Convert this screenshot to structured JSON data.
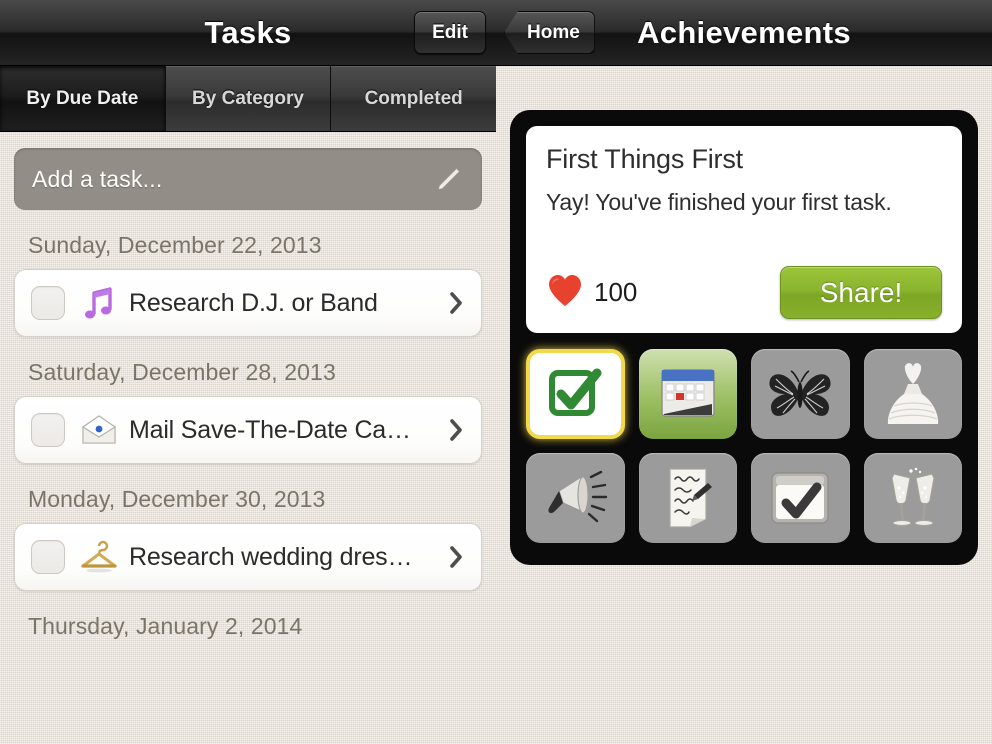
{
  "left_screen": {
    "nav": {
      "title": "Tasks",
      "edit_label": "Edit"
    },
    "segments": [
      {
        "label": "By Due Date",
        "active": true
      },
      {
        "label": "By Category",
        "active": false
      },
      {
        "label": "Completed",
        "active": false
      }
    ],
    "add_task": {
      "placeholder": "Add a task...",
      "icon": "pencil-icon"
    },
    "groups": [
      {
        "date": "Sunday, December 22, 2013",
        "tasks": [
          {
            "label": "Research D.J. or Band",
            "icon": "music-note-icon",
            "checked": false
          }
        ]
      },
      {
        "date": "Saturday, December 28, 2013",
        "tasks": [
          {
            "label": "Mail Save-The-Date Ca…",
            "icon": "envelope-icon",
            "checked": false
          }
        ]
      },
      {
        "date": "Monday, December 30, 2013",
        "tasks": [
          {
            "label": "Research wedding dres…",
            "icon": "hanger-icon",
            "checked": false
          }
        ]
      },
      {
        "date": "Thursday, January 2, 2014",
        "tasks": []
      }
    ]
  },
  "right_screen": {
    "nav": {
      "back_label": "Home",
      "title": "Achievements"
    },
    "card": {
      "title": "First Things First",
      "description": "Yay! You've finished your first task.",
      "points": "100",
      "points_icon": "heart-icon",
      "share_label": "Share!"
    },
    "badges": [
      {
        "name": "green-check-badge",
        "state": "unlocked",
        "style": "white"
      },
      {
        "name": "calendar-badge",
        "state": "unlocked",
        "style": "green"
      },
      {
        "name": "butterfly-badge",
        "state": "locked",
        "style": "gray"
      },
      {
        "name": "wedding-dress-badge",
        "state": "locked",
        "style": "gray"
      },
      {
        "name": "megaphone-badge",
        "state": "locked",
        "style": "gray"
      },
      {
        "name": "handwritten-note-badge",
        "state": "locked",
        "style": "gray"
      },
      {
        "name": "checklist-badge",
        "state": "locked",
        "style": "gray"
      },
      {
        "name": "champagne-toast-badge",
        "state": "locked",
        "style": "gray"
      }
    ]
  },
  "colors": {
    "linen": "#e6e1d6",
    "navbar": "#1a1a1a",
    "share_green": "#88b02b",
    "heart_red": "#e8412e",
    "badge_highlight": "#f2d94c",
    "add_task_gray": "#928d86",
    "date_text": "#7c7468"
  }
}
